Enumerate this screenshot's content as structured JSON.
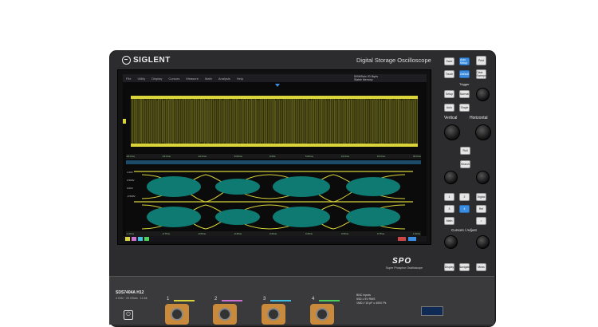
{
  "brand": {
    "name": "SIGLENT",
    "product_line": "Digital Storage Oscilloscope"
  },
  "menu": [
    "File",
    "Utility",
    "Display",
    "Cursors",
    "Measure",
    "Math",
    "Analysis",
    "Help"
  ],
  "acquisition": {
    "line1": "500MSa/s 20.0kpts",
    "line2": "Stable Memory"
  },
  "time_labels_top": [
    "-20.0ms",
    "-15.0ms",
    "-10.0ms",
    "-5.00ms",
    "0.00s",
    "5.00ms",
    "10.0ms",
    "15.0ms",
    "20.0ms"
  ],
  "time_labels_bottom": [
    "-1.00ns",
    "-0.75ns",
    "-0.50ns",
    "-0.25ns",
    "0.00ns",
    "0.25ns",
    "0.50ns",
    "0.75ns",
    "1.00ns"
  ],
  "eye_labels": [
    "1.00V",
    "0.500V",
    "0.00V",
    "-0.500V"
  ],
  "front_panel": {
    "top_buttons": [
      "Save",
      "Auto Setup",
      "Print",
      "Touch",
      "Default",
      "Clear Sweeps"
    ],
    "trigger_label": "Trigger",
    "trigger_buttons": [
      "Setup",
      "Normal",
      "Auto",
      "Single"
    ],
    "vertical_label": "Vertical",
    "horizontal_label": "Horizontal",
    "roll_button": "Roll",
    "search_button": "Search",
    "channel_buttons": [
      "1",
      "2",
      "3",
      "4"
    ],
    "digital_button": "Digital",
    "math_button": "Math",
    "ref_button": "Ref",
    "cursors_label": "Cursors / Adjust",
    "bottom_buttons": [
      "Display",
      "Navigate",
      "Meas"
    ]
  },
  "spo": {
    "logo": "SPO",
    "subtitle": "Super Phosphor Oscilloscope"
  },
  "model": {
    "name": "SDS7404A H12",
    "spec": "4 GHz · 20 GSa/s · 12-bit"
  },
  "inputs": [
    "1",
    "2",
    "3",
    "4"
  ],
  "warning": {
    "line1": "50Ω ≤ 5V RMS",
    "line2": "1MΩ // 15 pF ≤ 400V Pk",
    "heading": "BNC Inputs"
  },
  "colors": {
    "ch1": "#d8d43a",
    "trace_fill": "#0f7a72",
    "accent": "#3a8de0"
  }
}
